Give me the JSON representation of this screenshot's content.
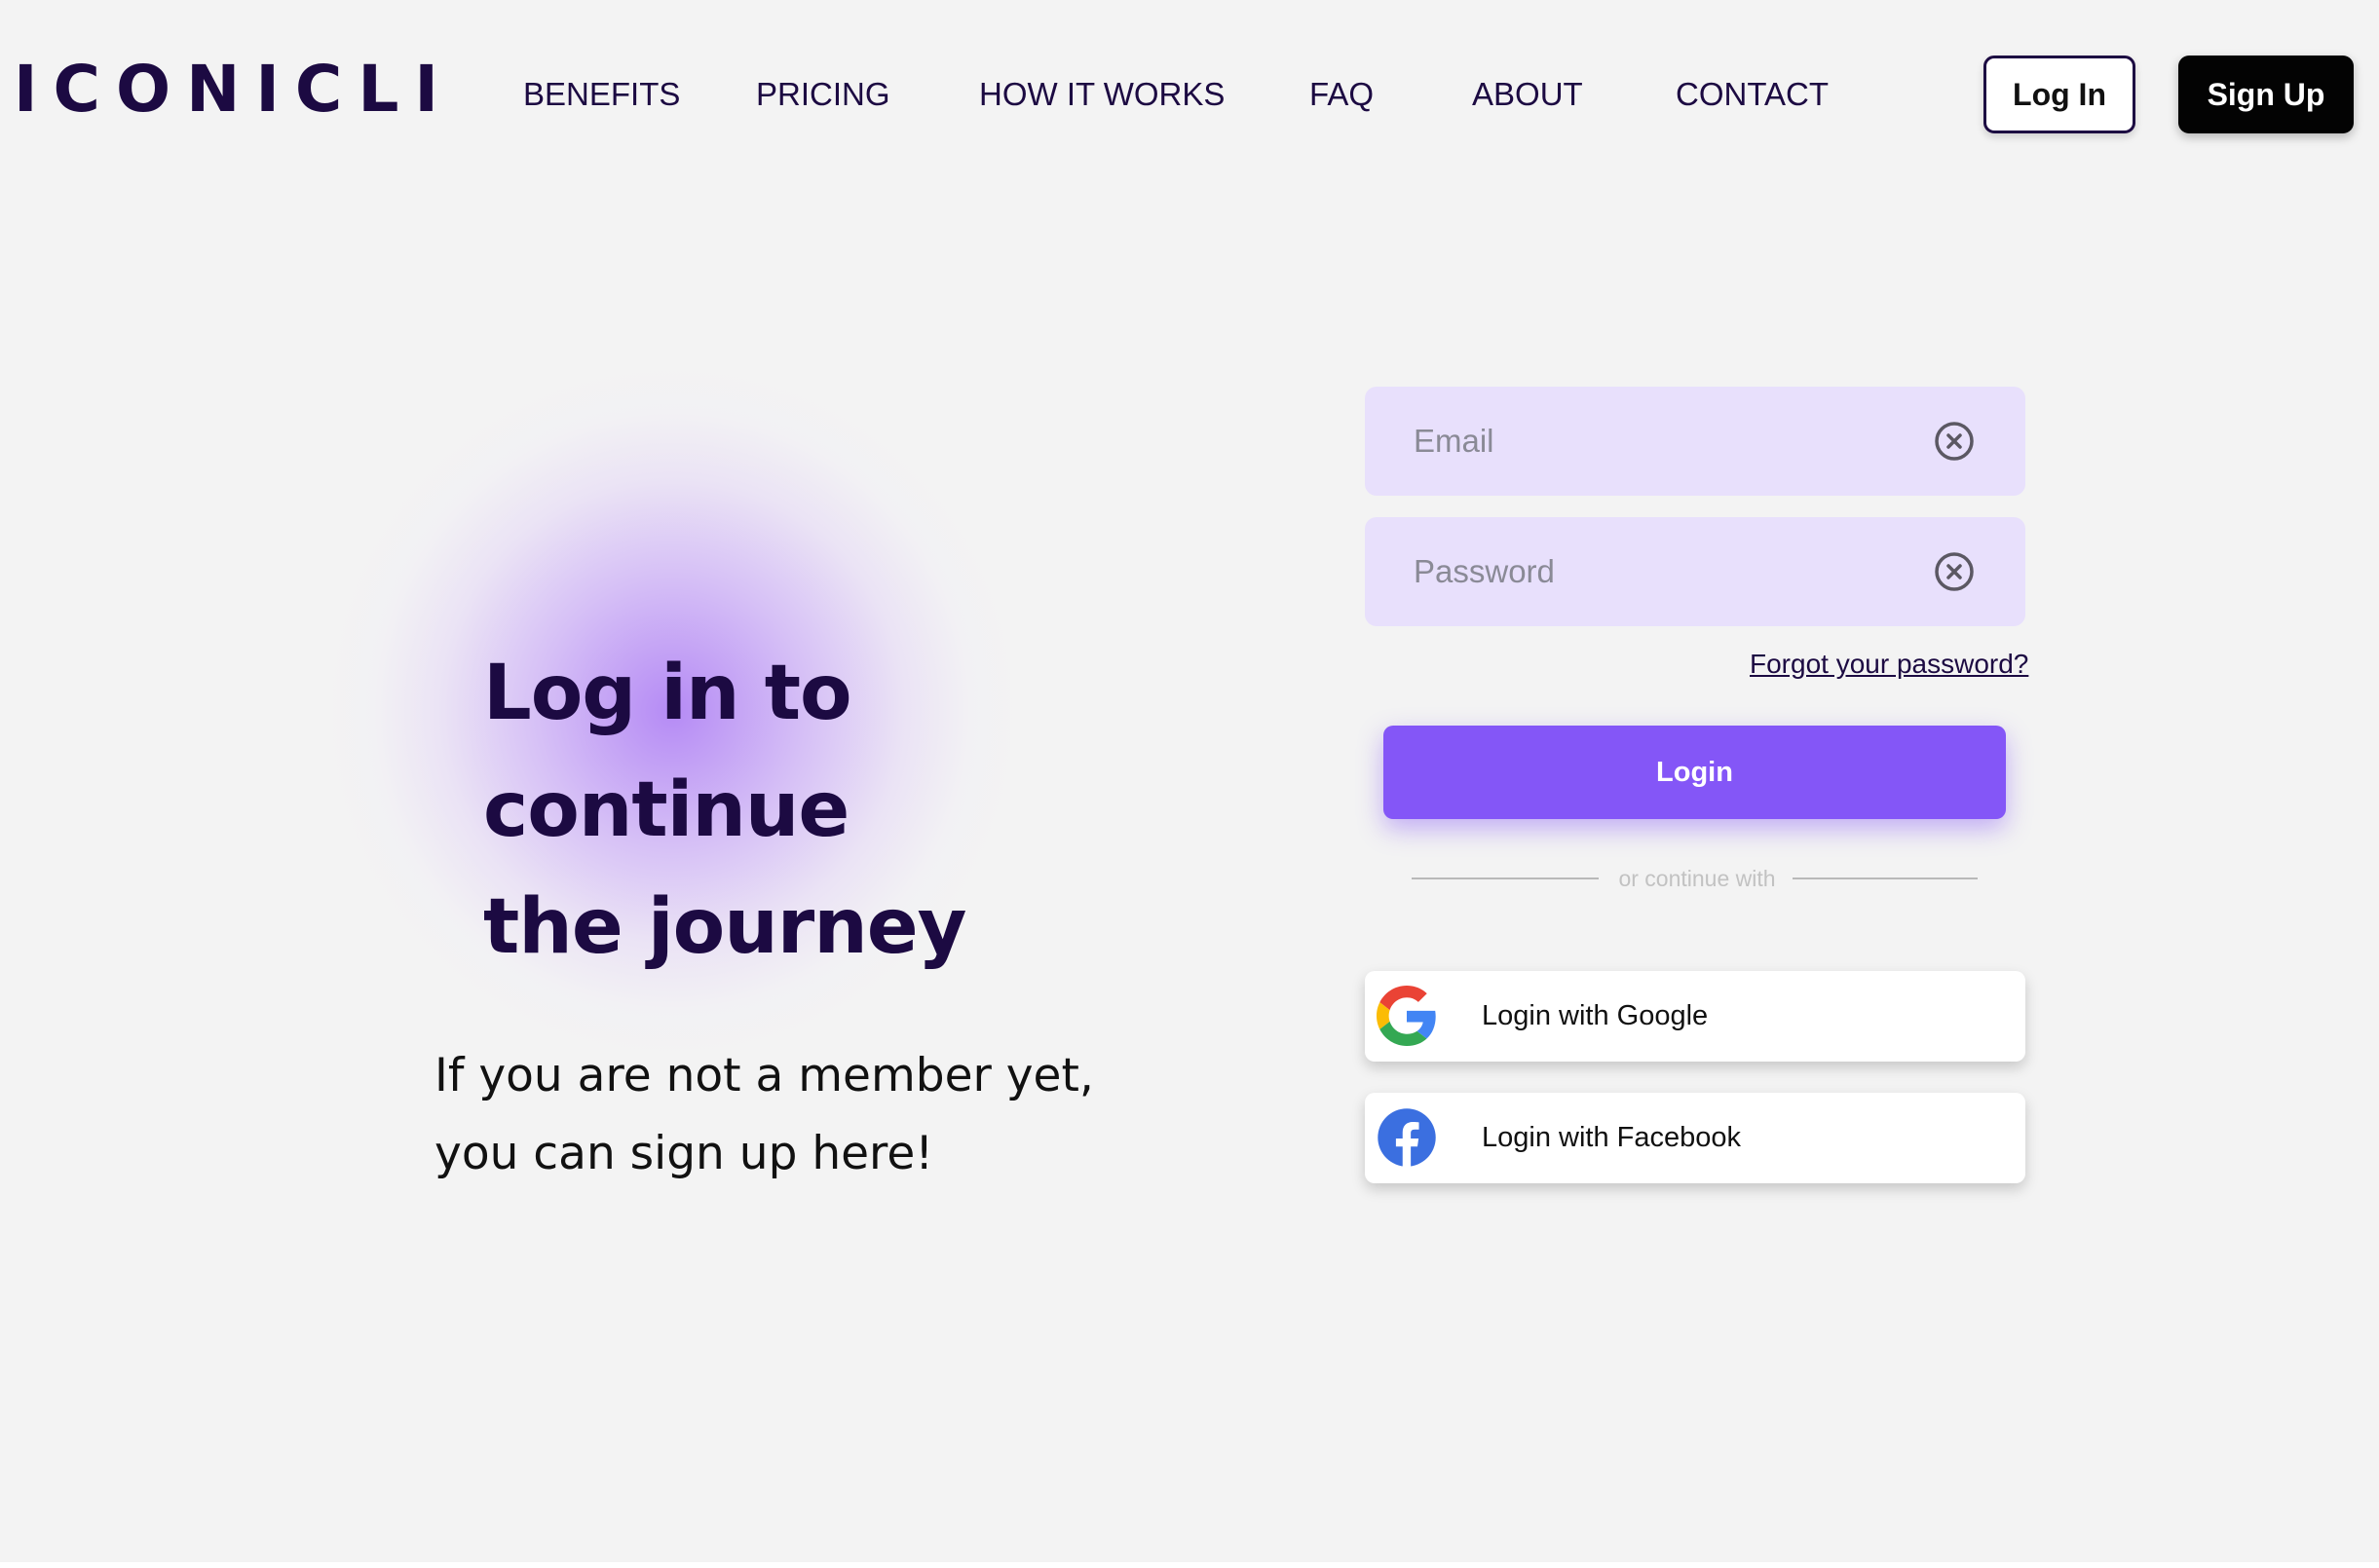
{
  "brand": {
    "logo_text": "ICONICLI"
  },
  "nav": {
    "items": [
      {
        "label": "BENEFITS"
      },
      {
        "label": "PRICING"
      },
      {
        "label": "HOW IT WORKS"
      },
      {
        "label": "FAQ"
      },
      {
        "label": "ABOUT"
      },
      {
        "label": "CONTACT"
      }
    ],
    "login_label": "Log In",
    "signup_label": "Sign Up"
  },
  "hero": {
    "title_line1": "Log in to continue",
    "title_line2": "the journey",
    "subtitle_line1": "If you are not a member yet,",
    "subtitle_line2": "you can sign up here!"
  },
  "form": {
    "email_placeholder": "Email",
    "email_value": "",
    "password_placeholder": "Password",
    "password_value": "",
    "forgot_label": "Forgot your password?",
    "login_button_label": "Login",
    "divider_label": "or continue with",
    "google_label": "Login with Google",
    "facebook_label": "Login with Facebook"
  },
  "colors": {
    "brand_dark": "#1c0a42",
    "accent_purple": "#8456f7",
    "field_bg": "#e8e0fc",
    "page_bg": "#f3f3f3",
    "facebook_blue": "#3b6fe0"
  },
  "icons": {
    "clear": "circle-x-icon",
    "google": "google-g-icon",
    "facebook": "facebook-f-icon"
  }
}
